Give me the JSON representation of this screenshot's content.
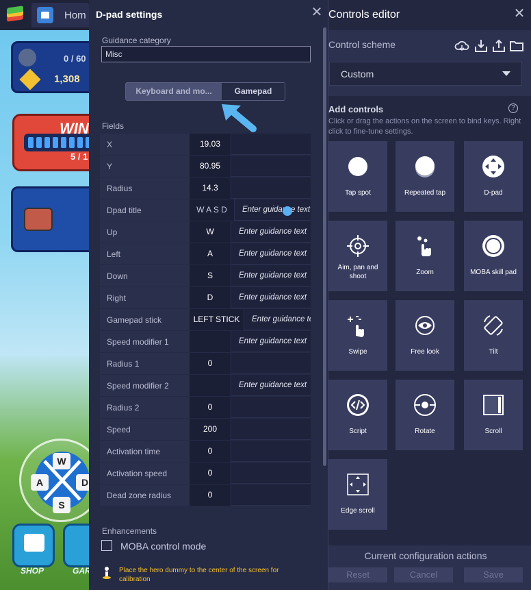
{
  "app": {
    "home_tab_label": "Hom"
  },
  "game": {
    "xp_value": "0 / 60",
    "gold_value": "1,308",
    "win_title": "WIN",
    "win_count": "5 / 1",
    "shop_label": "SHOP",
    "garage_label": "GAR"
  },
  "dpad_overlay": {
    "up_key": "W",
    "left_key": "A",
    "down_key": "S",
    "right_key": "D"
  },
  "dpad_settings": {
    "title": "D-pad settings",
    "guidance_category_label": "Guidance category",
    "guidance_category_value": "Misc",
    "tabs": [
      {
        "label": "Keyboard and mo...",
        "active": false
      },
      {
        "label": "Gamepad",
        "active": true
      }
    ],
    "fields_label": "Fields",
    "fields": [
      {
        "name": "X",
        "value": "19.03",
        "guidance": ""
      },
      {
        "name": "Y",
        "value": "80.95",
        "guidance": ""
      },
      {
        "name": "Radius",
        "value": "14.3",
        "guidance": ""
      },
      {
        "name": "Dpad title",
        "value": "W A S D",
        "guidance": "Enter guidance text"
      },
      {
        "name": "Up",
        "value": "W",
        "guidance": "Enter guidance text"
      },
      {
        "name": "Left",
        "value": "A",
        "guidance": "Enter guidance text"
      },
      {
        "name": "Down",
        "value": "S",
        "guidance": "Enter guidance text"
      },
      {
        "name": "Right",
        "value": "D",
        "guidance": "Enter guidance text"
      },
      {
        "name": "Gamepad stick",
        "value": "LEFT STICK",
        "guidance": "Enter guidance text"
      },
      {
        "name": "Speed modifier 1",
        "value": "",
        "guidance": "Enter guidance text"
      },
      {
        "name": "Radius 1",
        "value": "0",
        "guidance": ""
      },
      {
        "name": "Speed modifier 2",
        "value": "",
        "guidance": "Enter guidance text"
      },
      {
        "name": "Radius 2",
        "value": "0",
        "guidance": ""
      },
      {
        "name": "Speed",
        "value": "200",
        "guidance": ""
      },
      {
        "name": "Activation time",
        "value": "0",
        "guidance": ""
      },
      {
        "name": "Activation speed",
        "value": "0",
        "guidance": ""
      },
      {
        "name": "Dead zone radius",
        "value": "0",
        "guidance": ""
      }
    ],
    "enhancements_label": "Enhancements",
    "moba_label": "MOBA control mode",
    "moba_checked": false,
    "hint_text": "Place the hero dummy to the center of the screen for calibration"
  },
  "controls_editor": {
    "title": "Controls editor",
    "scheme_label": "Control scheme",
    "scheme_value": "Custom",
    "scheme_icons": [
      "cloud-icon",
      "import-icon",
      "export-icon",
      "folder-icon"
    ],
    "add_title": "Add controls",
    "add_desc": "Click or drag the actions on the screen to bind keys. Right click to fine-tune settings.",
    "controls": [
      {
        "label": "Tap spot",
        "icon": "tap-spot-icon"
      },
      {
        "label": "Repeated tap",
        "icon": "repeated-tap-icon"
      },
      {
        "label": "D-pad",
        "icon": "dpad-icon"
      },
      {
        "label": "Aim, pan and shoot",
        "icon": "crosshair-icon"
      },
      {
        "label": "Zoom",
        "icon": "zoom-gesture-icon"
      },
      {
        "label": "MOBA skill pad",
        "icon": "moba-skill-icon"
      },
      {
        "label": "Swipe",
        "icon": "swipe-icon"
      },
      {
        "label": "Free look",
        "icon": "eye-icon"
      },
      {
        "label": "Tilt",
        "icon": "tilt-icon"
      },
      {
        "label": "Script",
        "icon": "script-icon"
      },
      {
        "label": "Rotate",
        "icon": "rotate-icon"
      },
      {
        "label": "Scroll",
        "icon": "scroll-icon"
      },
      {
        "label": "Edge scroll",
        "icon": "edge-scroll-icon"
      }
    ],
    "actions_title": "Current configuration actions",
    "reset_label": "Reset",
    "cancel_label": "Cancel",
    "save_label": "Save"
  },
  "colors": {
    "panel_bg": "#252a45",
    "tile_bg": "#383d60",
    "accent_blue": "#5aaef2",
    "hint_yellow": "#f4c22a"
  }
}
